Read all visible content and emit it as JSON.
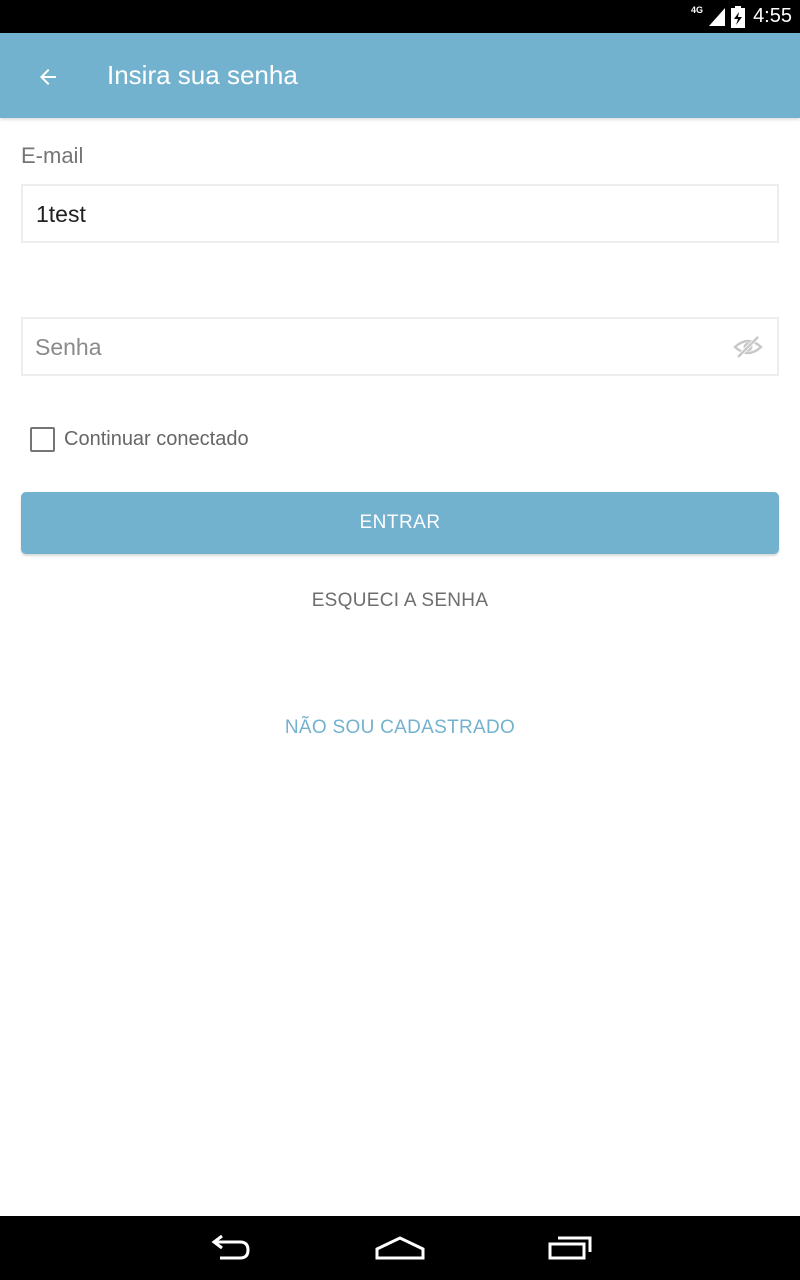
{
  "status_bar": {
    "network": "4G",
    "time": "4:55"
  },
  "app_bar": {
    "title": "Insira sua senha",
    "back_icon": "arrow-back-icon"
  },
  "form": {
    "email_label": "E-mail",
    "email_value": "1test",
    "password_placeholder": "Senha",
    "password_visibility_icon": "eye-off-icon",
    "remember_label": "Continuar conectado",
    "remember_checked": false,
    "login_label": "ENTRAR",
    "forgot_label": "ESQUECI A SENHA",
    "signup_label": "NÃO SOU CADASTRADO"
  },
  "nav_bar": {
    "back": "nav-back-icon",
    "home": "nav-home-icon",
    "recents": "nav-recents-icon"
  },
  "colors": {
    "accent": "#73b2cf",
    "status_bar": "#000000",
    "text_secondary": "#757575"
  }
}
